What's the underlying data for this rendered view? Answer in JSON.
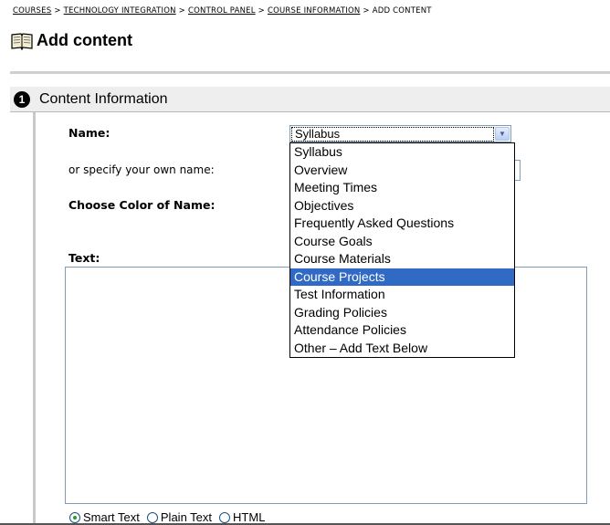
{
  "breadcrumb": {
    "items": [
      "COURSES",
      "TECHNOLOGY INTEGRATION",
      "CONTROL PANEL",
      "COURSE INFORMATION"
    ],
    "current": "ADD CONTENT",
    "separator": ">"
  },
  "page": {
    "title": "Add content"
  },
  "section": {
    "step": "1",
    "title": "Content Information"
  },
  "form": {
    "name_label": "Name:",
    "own_name_label": "or specify your own name:",
    "color_label": "Choose Color of Name:",
    "text_label": "Text:"
  },
  "name_select": {
    "value": "Syllabus",
    "options": [
      "Syllabus",
      "Overview",
      "Meeting Times",
      "Objectives",
      "Frequently Asked Questions",
      "Course Goals",
      "Course Materials",
      "Course Projects",
      "Test Information",
      "Grading Policies",
      "Attendance Policies",
      "Other – Add Text Below"
    ],
    "highlighted": "Course Projects"
  },
  "text_format": {
    "options": [
      "Smart Text",
      "Plain Text",
      "HTML"
    ],
    "selected": "Smart Text"
  },
  "colors": {
    "highlight": "#316ac5",
    "section_bg": "#eeeeee",
    "border": "#7f9db9"
  }
}
